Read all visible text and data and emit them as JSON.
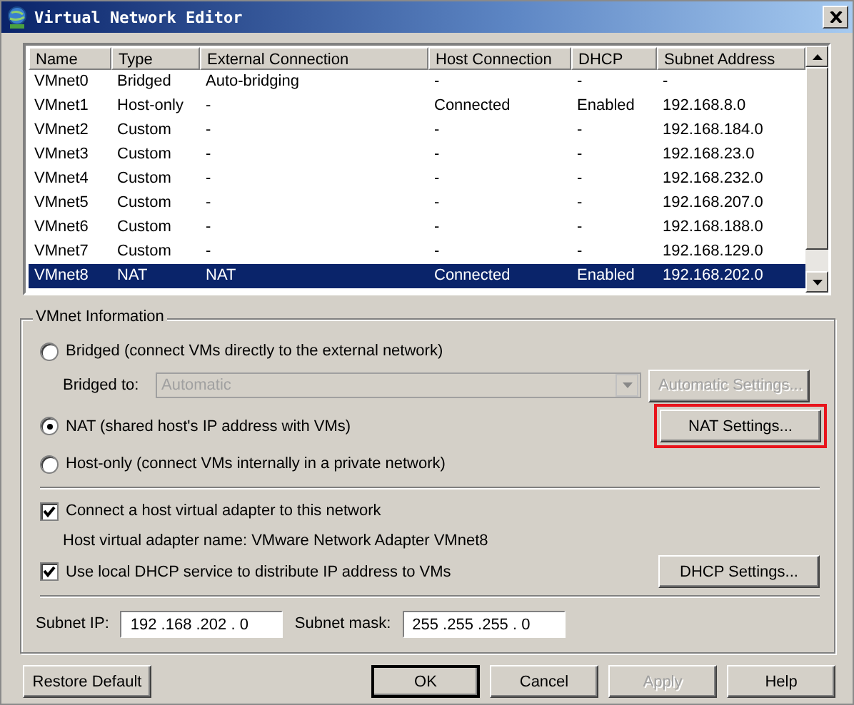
{
  "window": {
    "title": "Virtual Network Editor"
  },
  "table": {
    "columns": [
      "Name",
      "Type",
      "External Connection",
      "Host Connection",
      "DHCP",
      "Subnet Address"
    ],
    "rows": [
      {
        "cells": [
          "VMnet0",
          "Bridged",
          "Auto-bridging",
          "-",
          "-",
          "-"
        ],
        "selected": false
      },
      {
        "cells": [
          "VMnet1",
          "Host-only",
          "-",
          "Connected",
          "Enabled",
          "192.168.8.0"
        ],
        "selected": false
      },
      {
        "cells": [
          "VMnet2",
          "Custom",
          "-",
          "-",
          "-",
          "192.168.184.0"
        ],
        "selected": false
      },
      {
        "cells": [
          "VMnet3",
          "Custom",
          "-",
          "-",
          "-",
          "192.168.23.0"
        ],
        "selected": false
      },
      {
        "cells": [
          "VMnet4",
          "Custom",
          "-",
          "-",
          "-",
          "192.168.232.0"
        ],
        "selected": false
      },
      {
        "cells": [
          "VMnet5",
          "Custom",
          "-",
          "-",
          "-",
          "192.168.207.0"
        ],
        "selected": false
      },
      {
        "cells": [
          "VMnet6",
          "Custom",
          "-",
          "-",
          "-",
          "192.168.188.0"
        ],
        "selected": false
      },
      {
        "cells": [
          "VMnet7",
          "Custom",
          "-",
          "-",
          "-",
          "192.168.129.0"
        ],
        "selected": false
      },
      {
        "cells": [
          "VMnet8",
          "NAT",
          "NAT",
          "Connected",
          "Enabled",
          "192.168.202.0"
        ],
        "selected": true
      }
    ]
  },
  "vmnet_info": {
    "legend": "VMnet Information",
    "options": [
      {
        "label": "Bridged (connect VMs directly to the external network)",
        "selected": false
      },
      {
        "label": "NAT (shared host's IP address with VMs)",
        "selected": true
      },
      {
        "label": "Host-only (connect VMs internally in a private network)",
        "selected": false
      }
    ],
    "bridged_to": {
      "label": "Bridged to:",
      "value": "Automatic",
      "disabled": true
    },
    "automatic_settings": {
      "label": "Automatic Settings...",
      "disabled": true
    },
    "nat_settings": {
      "label": "NAT Settings...",
      "highlighted": true
    },
    "connect_adapter": {
      "label": "Connect a host virtual adapter to this network",
      "checked": true
    },
    "adapter_name": "Host virtual adapter name: VMware Network Adapter VMnet8",
    "use_dhcp": {
      "label": "Use local DHCP service to distribute IP address to VMs",
      "checked": true
    },
    "dhcp_settings": {
      "label": "DHCP Settings..."
    },
    "subnet_ip": {
      "label": "Subnet IP:",
      "value": "192 .168 .202 . 0"
    },
    "subnet_mask": {
      "label": "Subnet mask:",
      "value": "255 .255 .255 . 0"
    }
  },
  "restore_default": {
    "label": "Restore Default"
  },
  "buttons": [
    {
      "label": "OK",
      "default": true,
      "disabled": false
    },
    {
      "label": "Cancel",
      "default": false,
      "disabled": false
    },
    {
      "label": "Apply",
      "default": false,
      "disabled": true
    },
    {
      "label": "Help",
      "default": false,
      "disabled": false
    }
  ]
}
